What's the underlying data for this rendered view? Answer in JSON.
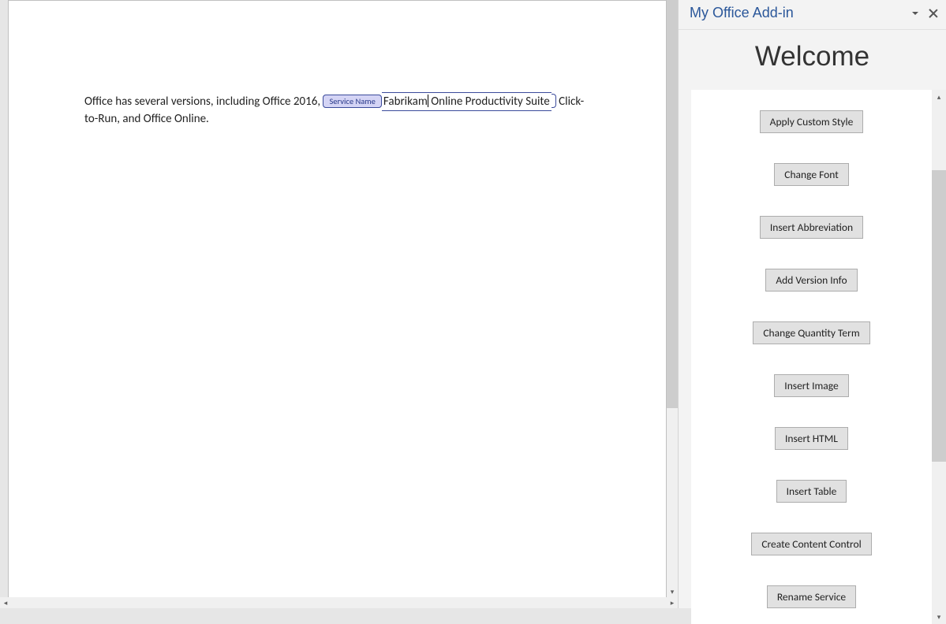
{
  "document": {
    "text_before_control": "Office has several versions, including Office 2016, ",
    "content_control": {
      "tag_label": "Service Name",
      "value_before_cursor": "Fabrikam",
      "value_after_cursor": " Online Productivity Suite"
    },
    "text_after_control": " Click-to-Run, and Office Online."
  },
  "addin": {
    "title": "My Office Add-in",
    "welcome": "Welcome",
    "buttons": [
      "Apply Custom Style",
      "Change Font",
      "Insert Abbreviation",
      "Add Version Info",
      "Change Quantity Term",
      "Insert Image",
      "Insert HTML",
      "Insert Table",
      "Create Content Control",
      "Rename Service"
    ]
  }
}
